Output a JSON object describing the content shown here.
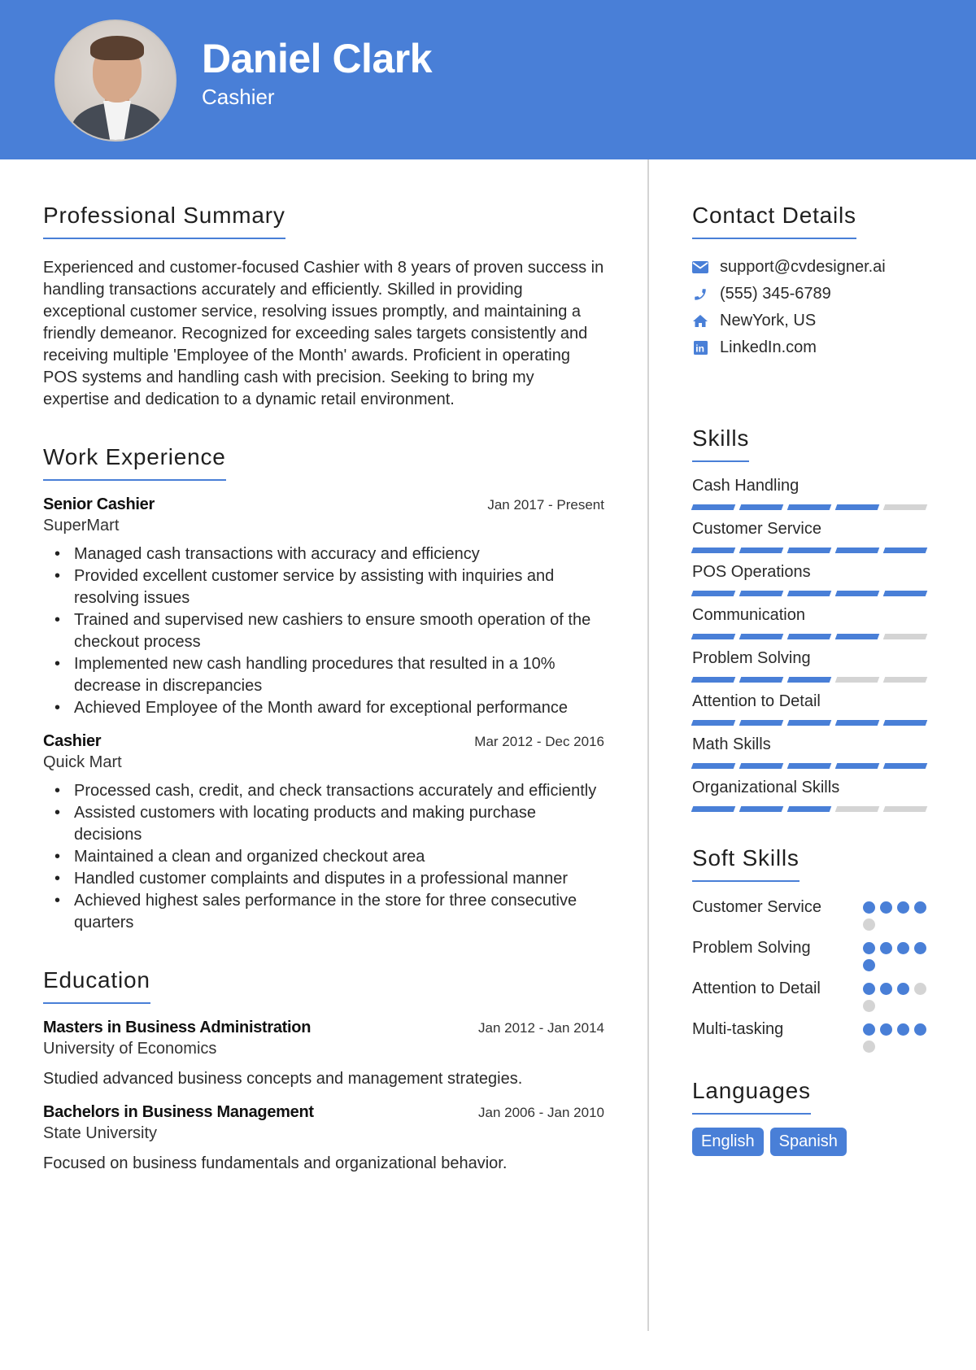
{
  "header": {
    "name": "Daniel Clark",
    "title": "Cashier",
    "accent_color": "#497fd7"
  },
  "summary": {
    "heading": "Professional Summary",
    "text": "Experienced and customer-focused Cashier with 8 years of proven success in handling transactions accurately and efficiently. Skilled in providing exceptional customer service, resolving issues promptly, and maintaining a friendly demeanor. Recognized for exceeding sales targets consistently and receiving multiple 'Employee of the Month' awards. Proficient in operating POS systems and handling cash with precision. Seeking to bring my expertise and dedication to a dynamic retail environment."
  },
  "experience": {
    "heading": "Work Experience",
    "jobs": [
      {
        "role": "Senior Cashier",
        "company": "SuperMart",
        "dates": "Jan 2017 - Present",
        "bullets": [
          "Managed cash transactions with accuracy and efficiency",
          "Provided excellent customer service by assisting with inquiries and resolving issues",
          "Trained and supervised new cashiers to ensure smooth operation of the checkout process",
          "Implemented new cash handling procedures that resulted in a 10% decrease in discrepancies",
          "Achieved Employee of the Month award for exceptional performance"
        ]
      },
      {
        "role": "Cashier",
        "company": "Quick Mart",
        "dates": "Mar 2012 - Dec 2016",
        "bullets": [
          "Processed cash, credit, and check transactions accurately and efficiently",
          "Assisted customers with locating products and making purchase decisions",
          "Maintained a clean and organized checkout area",
          "Handled customer complaints and disputes in a professional manner",
          "Achieved highest sales performance in the store for three consecutive quarters"
        ]
      }
    ]
  },
  "education": {
    "heading": "Education",
    "items": [
      {
        "degree": "Masters in Business Administration",
        "school": "University of Economics",
        "dates": "Jan 2012 - Jan 2014",
        "description": "Studied advanced business concepts and management strategies."
      },
      {
        "degree": "Bachelors in Business Management",
        "school": "State University",
        "dates": "Jan 2006 - Jan 2010",
        "description": "Focused on business fundamentals and organizational behavior."
      }
    ]
  },
  "contact": {
    "heading": "Contact Details",
    "items": [
      {
        "icon": "envelope-icon",
        "text": "support@cvdesigner.ai"
      },
      {
        "icon": "phone-icon",
        "text": "(555) 345-6789"
      },
      {
        "icon": "home-icon",
        "text": "NewYork, US"
      },
      {
        "icon": "linkedin-icon",
        "text": "LinkedIn.com"
      }
    ]
  },
  "skills": {
    "heading": "Skills",
    "max": 5,
    "items": [
      {
        "label": "Cash Handling",
        "level": 4
      },
      {
        "label": "Customer Service",
        "level": 5
      },
      {
        "label": "POS Operations",
        "level": 5
      },
      {
        "label": "Communication",
        "level": 4
      },
      {
        "label": "Problem Solving",
        "level": 3
      },
      {
        "label": "Attention to Detail",
        "level": 5
      },
      {
        "label": "Math Skills",
        "level": 5
      },
      {
        "label": "Organizational Skills",
        "level": 3
      }
    ]
  },
  "soft_skills": {
    "heading": "Soft Skills",
    "max": 5,
    "items": [
      {
        "label": "Customer Service",
        "level": 4
      },
      {
        "label": "Problem Solving",
        "level": 5
      },
      {
        "label": "Attention to Detail",
        "level": 3
      },
      {
        "label": "Multi-tasking",
        "level": 4
      }
    ]
  },
  "languages": {
    "heading": "Languages",
    "items": [
      "English",
      "Spanish"
    ]
  }
}
